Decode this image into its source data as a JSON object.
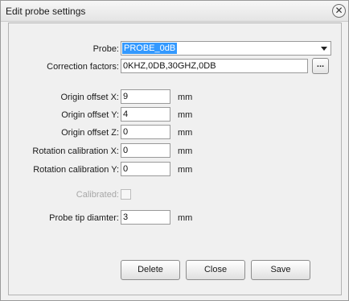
{
  "window": {
    "title": "Edit probe settings",
    "close_glyph": "✕"
  },
  "form": {
    "probe": {
      "label": "Probe:",
      "value": "PROBE_0dB"
    },
    "correction": {
      "label": "Correction factors:",
      "value": "0KHZ,0DB,30GHZ,0DB",
      "browse_label": "..."
    },
    "origin_x": {
      "label": "Origin offset X:",
      "value": "9",
      "unit": "mm"
    },
    "origin_y": {
      "label": "Origin offset Y:",
      "value": "4",
      "unit": "mm"
    },
    "origin_z": {
      "label": "Origin offset Z:",
      "value": "0",
      "unit": "mm"
    },
    "rot_x": {
      "label": "Rotation calibration X:",
      "value": "0",
      "unit": "mm"
    },
    "rot_y": {
      "label": "Rotation calibration Y:",
      "value": "0",
      "unit": "mm"
    },
    "calibrated": {
      "label": "Calibrated:",
      "checked": false
    },
    "tip_diameter": {
      "label": "Probe tip diamter:",
      "value": "3",
      "unit": "mm"
    }
  },
  "buttons": {
    "delete": "Delete",
    "close": "Close",
    "save": "Save"
  }
}
